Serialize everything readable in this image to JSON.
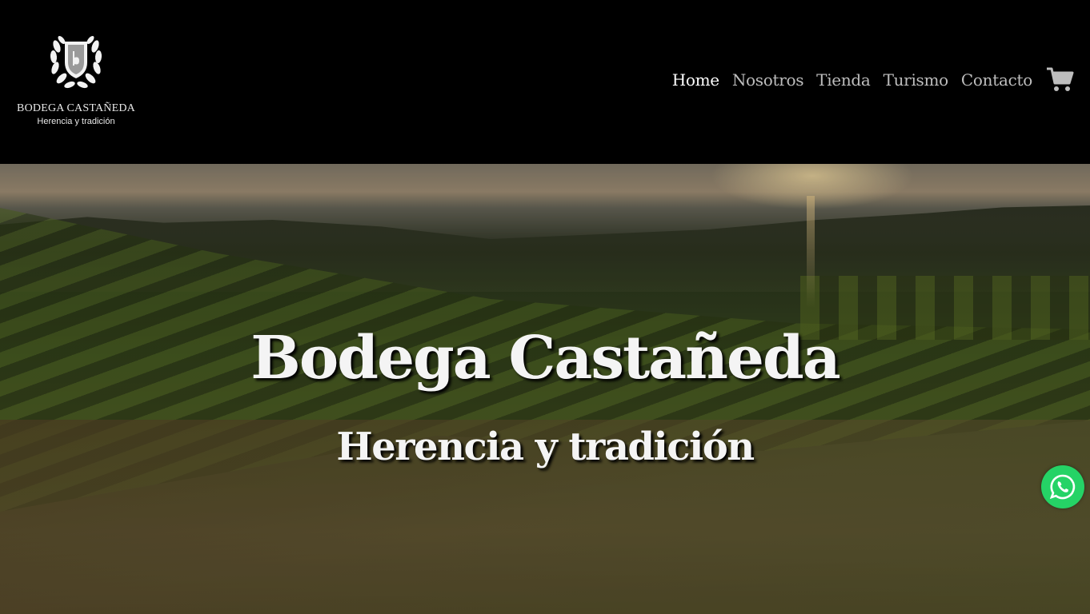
{
  "brand": {
    "name": "BODEGA CASTAÑEDA",
    "tagline": "Herencia y tradición",
    "logo_icon": "laurel-shield-icon"
  },
  "nav": {
    "items": [
      {
        "label": "Home",
        "active": true
      },
      {
        "label": "Nosotros",
        "active": false
      },
      {
        "label": "Tienda",
        "active": false
      },
      {
        "label": "Turismo",
        "active": false
      },
      {
        "label": "Contacto",
        "active": false
      }
    ],
    "cart_icon": "shopping-cart-icon"
  },
  "hero": {
    "title": "Bodega Castañeda",
    "subtitle": "Herencia y tradición",
    "background": "vineyard-sunrise-photo"
  },
  "floating": {
    "whatsapp_icon": "whatsapp-icon",
    "whatsapp_color": "#25d366"
  },
  "colors": {
    "header_bg": "#000000",
    "nav_active": "#ffffff",
    "nav_inactive": "#bdbdbd"
  }
}
